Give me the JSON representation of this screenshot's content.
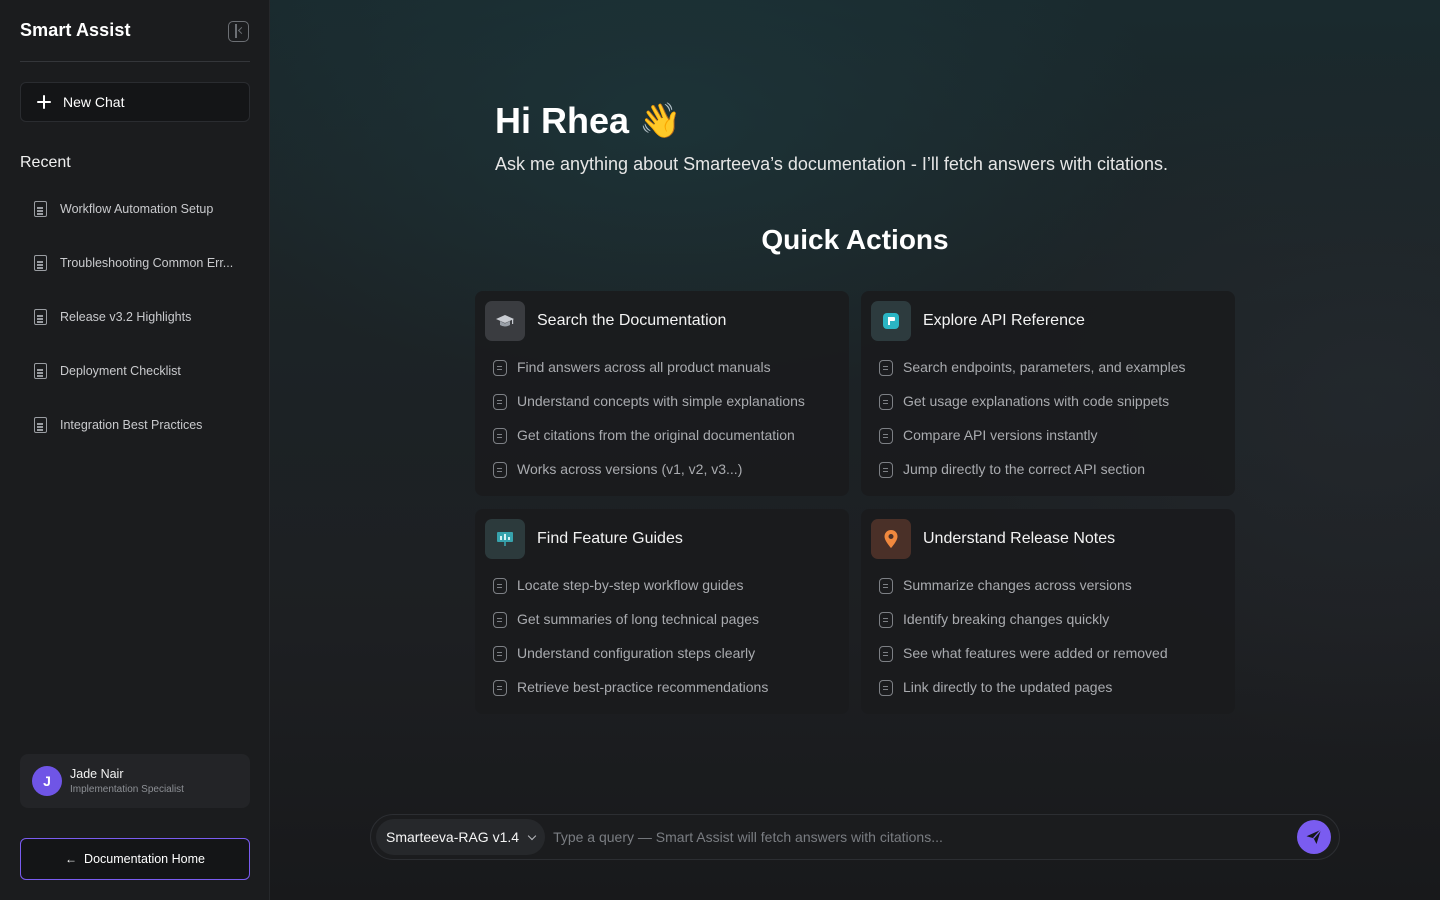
{
  "app": {
    "title": "Smart Assist"
  },
  "sidebar": {
    "new_chat_label": "New Chat",
    "recent_title": "Recent",
    "recent_items": [
      {
        "label": "Workflow Automation Setup"
      },
      {
        "label": "Troubleshooting Common Err..."
      },
      {
        "label": "Release v3.2 Highlights"
      },
      {
        "label": "Deployment Checklist"
      },
      {
        "label": "Integration Best Practices"
      }
    ],
    "user": {
      "initial": "J",
      "name": "Jade Nair",
      "role": "Implementation Specialist"
    },
    "doc_home_label": "Documentation Home"
  },
  "main": {
    "greeting": "Hi Rhea",
    "greeting_emoji": "👋",
    "subtitle": "Ask me anything about Smarteeva’s documentation - I’ll fetch answers with citations.",
    "quick_actions_title": "Quick Actions",
    "cards": [
      {
        "title": "Search the Documentation",
        "icon": "graduation-cap-icon",
        "items": [
          "Find answers across all product manuals",
          "Understand concepts with simple explanations",
          "Get citations from the original documentation",
          "Works across versions (v1, v2, v3...)"
        ]
      },
      {
        "title": "Explore API Reference",
        "icon": "api-icon",
        "items": [
          "Search endpoints, parameters, and examples",
          "Get usage explanations with code snippets",
          "Compare API versions instantly",
          "Jump directly to the correct API section"
        ]
      },
      {
        "title": "Find Feature Guides",
        "icon": "presentation-board-icon",
        "items": [
          "Locate step-by-step workflow guides",
          "Get summaries of long technical pages",
          "Understand configuration steps clearly",
          "Retrieve best-practice recommendations"
        ]
      },
      {
        "title": "Understand Release Notes",
        "icon": "location-pin-icon",
        "items": [
          "Summarize changes across versions",
          "Identify breaking changes quickly",
          "See what features were added or removed",
          "Link directly to the updated pages"
        ]
      }
    ]
  },
  "composer": {
    "model": "Smarteeva-RAG v1.4",
    "placeholder": "Type a query — Smart Assist will fetch answers with citations..."
  },
  "colors": {
    "accent": "#7a5cf0",
    "sidebar_bg": "#1b1c1e",
    "card_bg": "#1a1b1d"
  }
}
